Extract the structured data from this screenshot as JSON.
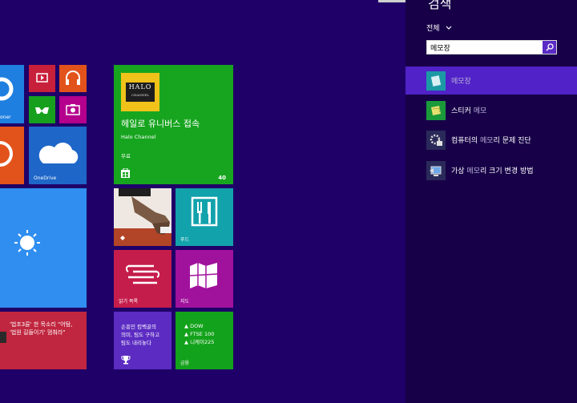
{
  "search_pane": {
    "title": "검색",
    "scope_label": "전체",
    "query": "메모장",
    "results": [
      {
        "bold": "",
        "dim": "메모장",
        "rest": ""
      },
      {
        "bold": "스티커 ",
        "dim": "메모",
        "rest": ""
      },
      {
        "bold": "컴퓨터의 ",
        "dim": "메모",
        "rest": "리 문제 진단"
      },
      {
        "bold": "가상 ",
        "dim": "메모",
        "rest": "리 크기 변경 방법"
      }
    ]
  },
  "tiles": {
    "onedrive_partial": "oner",
    "onedrive": "OneDrive",
    "halo": {
      "title": "헤일로 유니버스 접속",
      "subtitle": "Halo Channel",
      "price": "무료",
      "rating": "40",
      "logo_top": "HALO",
      "logo_bottom": "CHANNEL"
    },
    "food": "푸드",
    "reading_list": "읽기 목록",
    "maps": "지도",
    "news": {
      "line1": "'법조3륜' 한 목소리 \"어탐,",
      "line2": "'법원 길들이기' 멈춰라\""
    },
    "sports": {
      "line1": "손흥민 킴벡골의",
      "line2": "의미, 팀도 구하고",
      "line3": "팀도 내리놓다"
    },
    "finance": {
      "items": [
        "▲ DOW",
        "▲ FTSE 100",
        "▲ 니케이225"
      ],
      "label": "금융"
    }
  }
}
